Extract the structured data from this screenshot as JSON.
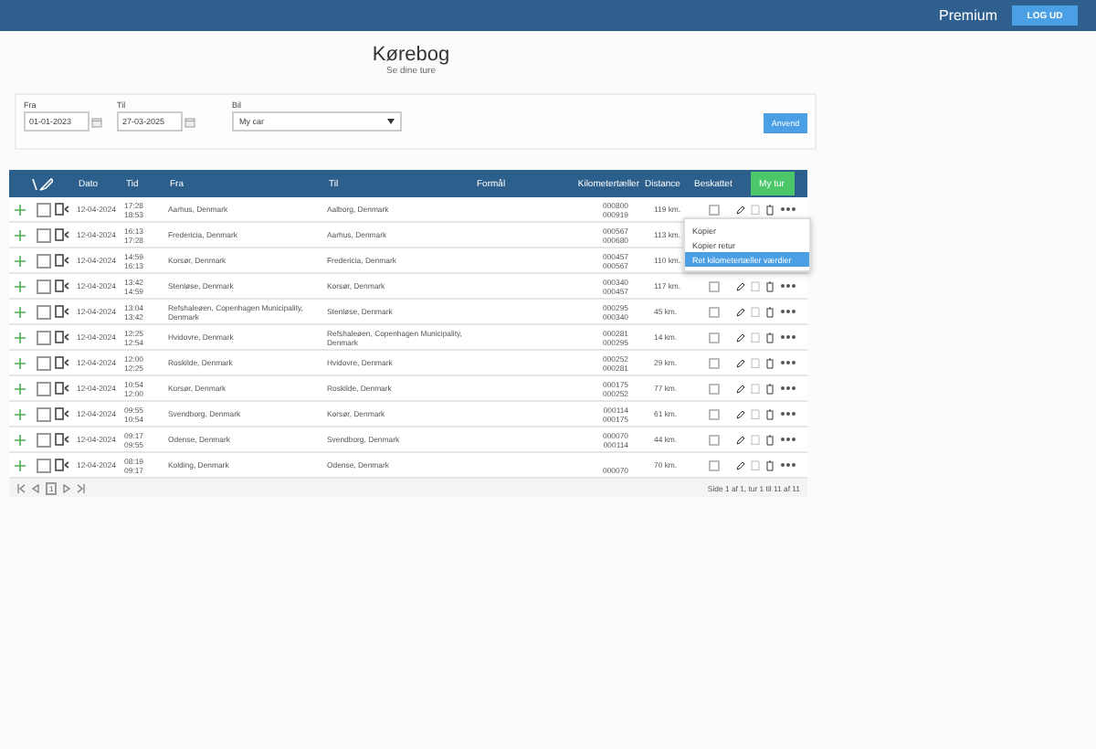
{
  "top_bar": {
    "plan": "Premium",
    "logout_button": "LOG UD"
  },
  "page": {
    "title": "Kørebog",
    "subtitle": "Se dine ture"
  },
  "filters": {
    "from_label": "Fra",
    "from_value": "01-01-2023",
    "to_label": "Til",
    "to_value": "27-03-2025",
    "car_label": "Bil",
    "car_value": "My car",
    "apply_button": "Anvend"
  },
  "table": {
    "columns": [
      "Dato",
      "Tid",
      "Fra",
      "Til",
      "Formål",
      "Kilometertæller",
      "Distance",
      "Beskattet"
    ],
    "new_trip_button": "My tur",
    "rows": [
      {
        "selected": false,
        "date": "12-04-2024",
        "start_time": "17:28",
        "end_time": "18:53",
        "from": "Aarhus, Denmark",
        "to": "Aalborg, Denmark",
        "odometer_start": "000800",
        "odometer_end": "000919",
        "distance": "119 km.",
        "taxed": false
      },
      {
        "selected": false,
        "date": "12-04-2024",
        "start_time": "16:13",
        "end_time": "17:28",
        "from": "Fredericia, Denmark",
        "to": "Aarhus, Denmark",
        "odometer_start": "000567",
        "odometer_end": "000680",
        "distance": "113 km."
      },
      {
        "selected": false,
        "date": "12-04-2024",
        "start_time": "14:59",
        "end_time": "16:13",
        "from": "Korsør, Denmark",
        "to": "Fredericia, Denmark",
        "odometer_start": "000457",
        "odometer_end": "000567",
        "distance": "110 km."
      },
      {
        "selected": false,
        "date": "12-04-2024",
        "start_time": "13:42",
        "end_time": "14:59",
        "from": "Stenløse, Denmark",
        "to": "Korsør, Denmark",
        "odometer_start": "000340",
        "odometer_end": "000457",
        "distance": "117 km.",
        "taxed": false
      },
      {
        "selected": false,
        "date": "12-04-2024",
        "start_time": "13:04",
        "end_time": "13:42",
        "from": "Refshaleøen, Copenhagen Municipality, Denmark",
        "to": "Stenløse, Denmark",
        "odometer_start": "000295",
        "odometer_end": "000340",
        "distance": "45 km.",
        "taxed": false
      },
      {
        "selected": false,
        "date": "12-04-2024",
        "start_time": "12:25",
        "end_time": "12:54",
        "from": "Hvidovre, Denmark",
        "to": "Refshaleøen, Copenhagen Municipality, Denmark",
        "odometer_start": "000281",
        "odometer_end": "000295",
        "distance": "14 km.",
        "taxed": false
      },
      {
        "selected": false,
        "date": "12-04-2024",
        "start_time": "12:00",
        "end_time": "12:25",
        "from": "Roskilde, Denmark",
        "to": "Hvidovre, Denmark",
        "odometer_start": "000252",
        "odometer_end": "000281",
        "distance": "29 km.",
        "taxed": false
      },
      {
        "selected": false,
        "date": "12-04-2024",
        "start_time": "10:54",
        "end_time": "12:00",
        "from": "Korsør, Denmark",
        "to": "Roskilde, Denmark",
        "odometer_start": "000175",
        "odometer_end": "000252",
        "distance": "77 km.",
        "taxed": false
      },
      {
        "selected": false,
        "date": "12-04-2024",
        "start_time": "09:55",
        "end_time": "10:54",
        "from": "Svendborg, Denmark",
        "to": "Korsør, Denmark",
        "odometer_start": "000114",
        "odometer_end": "000175",
        "distance": "61 km.",
        "taxed": false
      },
      {
        "selected": false,
        "date": "12-04-2024",
        "start_time": "09:17",
        "end_time": "09:55",
        "from": "Odense, Denmark",
        "to": "Svendborg, Denmark",
        "odometer_start": "000070",
        "odometer_end": "000114",
        "distance": "44 km.",
        "taxed": false
      },
      {
        "selected": false,
        "date": "12-04-2024",
        "start_time": "08:19",
        "end_time": "09:17",
        "from": "Kolding, Denmark",
        "to": "Odense, Denmark",
        "odometer_end": "000070",
        "distance": "70 km.",
        "taxed": false
      }
    ],
    "pagination": "Side 1 af 1, tur 1 til 11 af 11",
    "current_page": "1"
  },
  "action_menu": {
    "items": [
      {
        "label": "Kopier",
        "selected": false
      },
      {
        "label": "Kopier retur",
        "selected": false
      },
      {
        "label": "Ret kilometertæller værdier",
        "selected": true
      }
    ]
  }
}
